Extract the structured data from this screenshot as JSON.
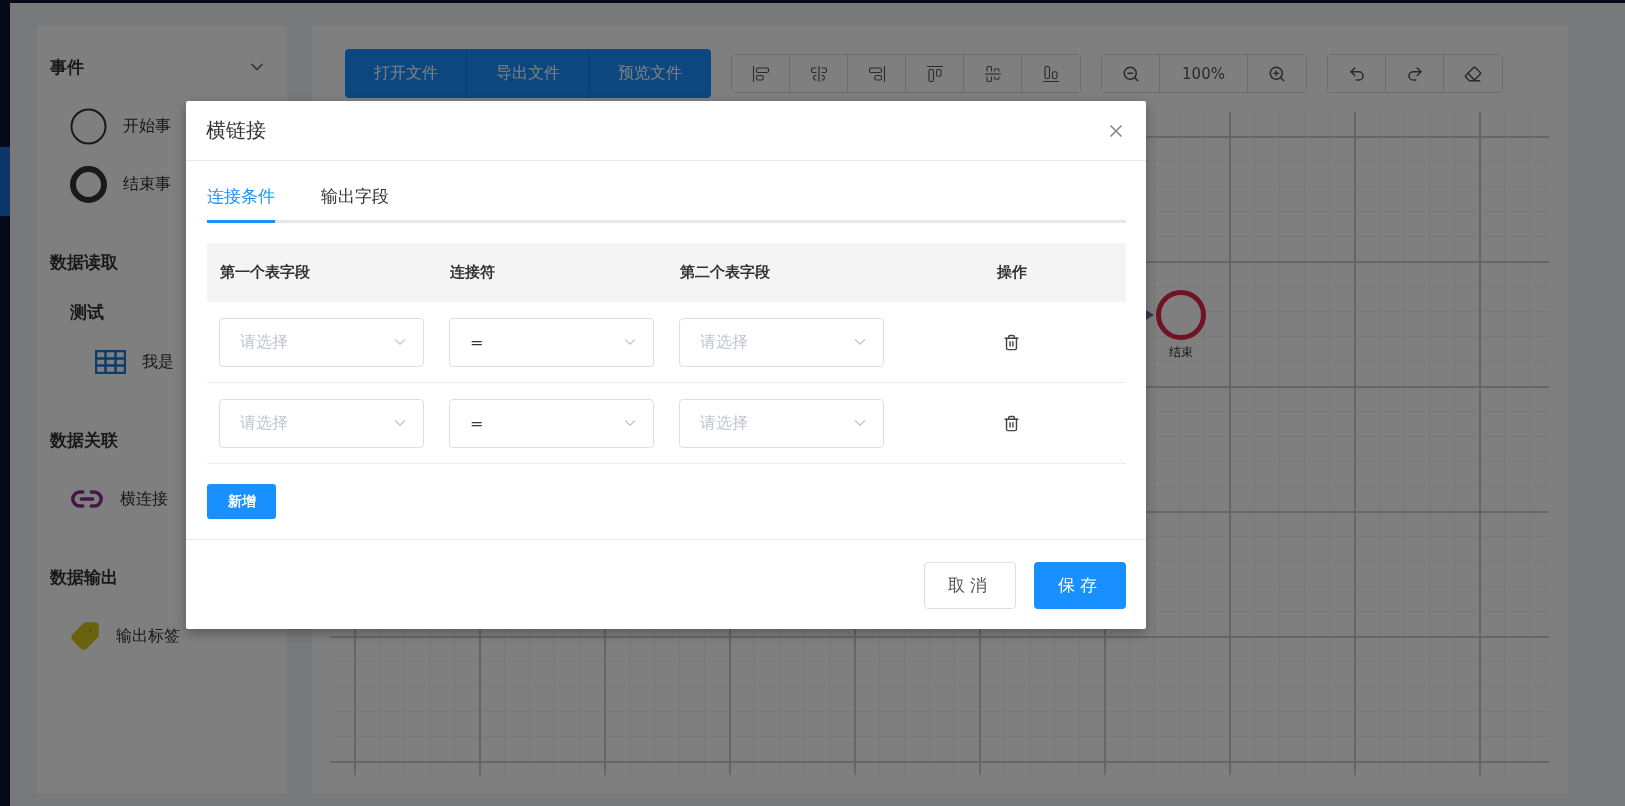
{
  "sidebar": {
    "sections": [
      {
        "title": "事件",
        "items": [
          {
            "kind": "start",
            "label": "开始事"
          },
          {
            "kind": "end",
            "label": "结束事"
          }
        ]
      },
      {
        "title": "数据读取",
        "items": [
          {
            "kind": "group",
            "label": "测试",
            "children": [
              {
                "kind": "table",
                "label": "我是"
              }
            ]
          }
        ]
      },
      {
        "title": "数据关联",
        "items": [
          {
            "kind": "link",
            "label": "横连接"
          }
        ]
      },
      {
        "title": "数据输出",
        "items": [
          {
            "kind": "tag",
            "label": "输出标签"
          }
        ]
      }
    ]
  },
  "toolbar": {
    "file_buttons": [
      "打开文件",
      "导出文件",
      "预览文件"
    ],
    "zoom": "100%"
  },
  "canvas": {
    "nodes": [
      {
        "kind": "end",
        "label": "结束"
      }
    ]
  },
  "dialog": {
    "title": "横链接",
    "tabs": [
      {
        "label": "连接条件",
        "selected": true
      },
      {
        "label": "输出字段",
        "selected": false
      }
    ],
    "table": {
      "columns": [
        "第一个表字段",
        "连接符",
        "第二个表字段",
        "操作"
      ],
      "rows": [
        {
          "first_field": {
            "placeholder": "请选择"
          },
          "operator": {
            "value": "="
          },
          "second_field": {
            "placeholder": "请选择"
          }
        },
        {
          "first_field": {
            "placeholder": "请选择"
          },
          "operator": {
            "value": "="
          },
          "second_field": {
            "placeholder": "请选择"
          }
        }
      ]
    },
    "add_button": "新增",
    "buttons": [
      {
        "label": "取消",
        "kind": "default"
      },
      {
        "label": "保存",
        "kind": "primary"
      }
    ]
  }
}
